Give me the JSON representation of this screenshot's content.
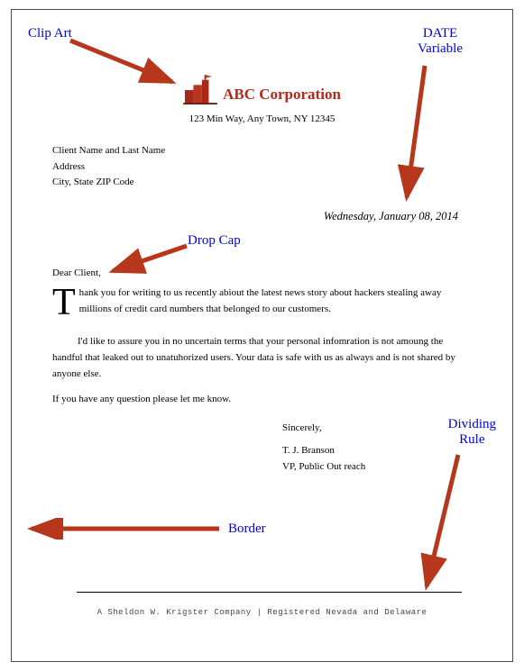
{
  "annotations": {
    "clip_art": "Clip Art",
    "date_variable": "DATE\nVariable",
    "drop_cap": "Drop Cap",
    "dividing_rule": "Dividing\nRule",
    "border": "Border"
  },
  "letterhead": {
    "company": "ABC Corporation",
    "address": "123 Min Way, Any Town, NY 12345"
  },
  "client": {
    "name_line": "Client Name and Last Name",
    "address_line": "Address",
    "city_line": "City, State ZIP Code"
  },
  "date": "Wednesday, January 08, 2014",
  "salutation": "Dear Client,",
  "body": {
    "dropcap": "T",
    "p1_rest": "hank you for writing to us recently abiout the latest news story about hackers stealing away millions of credit card numbers that belonged to our customers.",
    "p2": "I'd like to assure you in no uncertain terms that your personal infomration is not amoung the handful that leaked out to unatuhorized users. Your data is safe with us as always and is not shared by anyone else.",
    "p3": "If you have any question please let me know."
  },
  "signoff": {
    "closing": "Sincerely,",
    "name": "T. J. Branson",
    "title": "VP, Public Out reach"
  },
  "footer": "A Sheldon W. Krigster Company | Registered Nevada and Delaware",
  "colors": {
    "annotation": "#0000dd",
    "arrow": "#b7371c",
    "brand": "#b22a1c"
  }
}
